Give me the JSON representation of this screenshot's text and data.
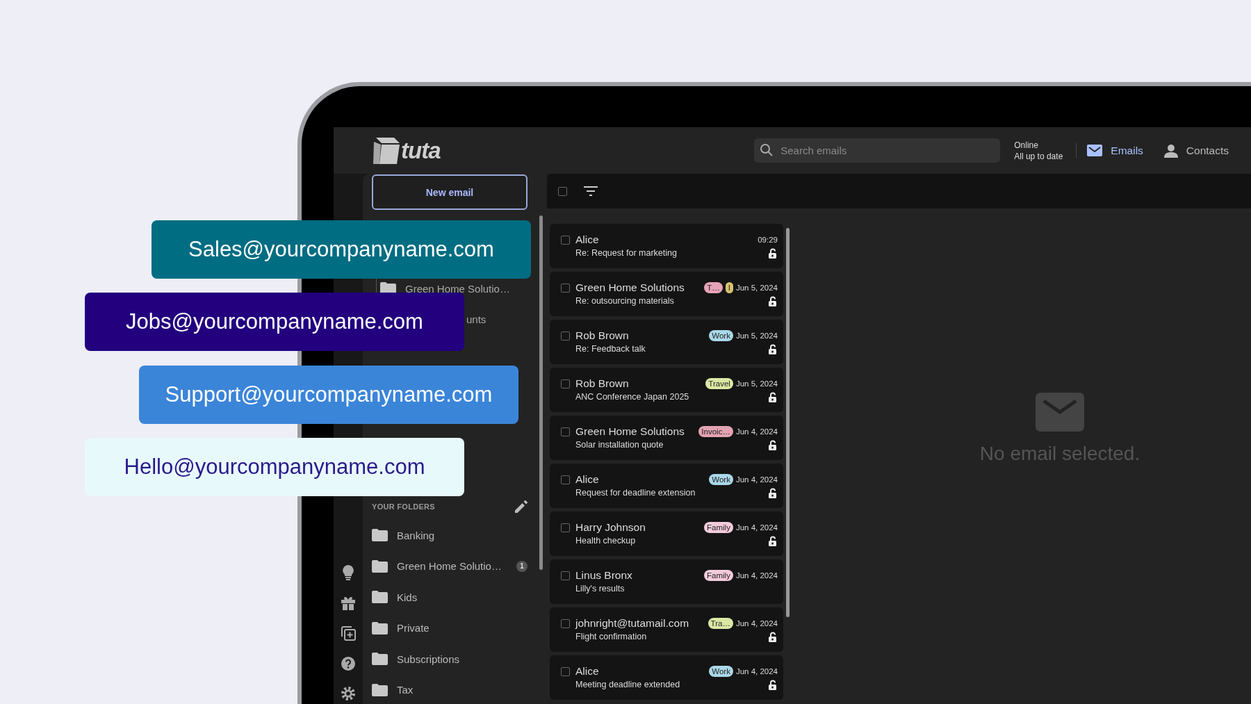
{
  "promo_cards": [
    {
      "address": "Sales@yourcompanyname.com",
      "color": "#006d82"
    },
    {
      "address": "Jobs@yourcompanyname.com",
      "color": "#22007e"
    },
    {
      "address": "Support@yourcompanyname.com",
      "color": "#3b85d9"
    },
    {
      "address": "Hello@yourcompanyname.com",
      "color": "#e8f9fc"
    }
  ],
  "app": {
    "logo_text": "tuta",
    "search": {
      "placeholder": "Search emails"
    },
    "status": {
      "connection": "Online",
      "sync": "All up to date"
    },
    "nav": [
      {
        "label": "Emails",
        "kind": "mail",
        "selected": true
      },
      {
        "label": "Contacts",
        "kind": "contacts",
        "selected": false
      }
    ]
  },
  "sidebar": {
    "new_email_button": "New email",
    "partial_folders": [
      {
        "label": "Green Home Solutio…",
        "kind": "subfolder"
      },
      {
        "label": "unts",
        "kind": "clipped"
      }
    ],
    "your_folders": {
      "heading": "YOUR FOLDERS",
      "items": [
        {
          "label": "Banking"
        },
        {
          "label": "Green Home Solutio…",
          "badge": "1"
        },
        {
          "label": "Kids"
        },
        {
          "label": "Private"
        },
        {
          "label": "Subscriptions"
        },
        {
          "label": "Tax"
        }
      ]
    }
  },
  "toolbar": {
    "select_all_checked": false
  },
  "emails": [
    {
      "sender": "Alice",
      "subject": "Re: Request for marketing",
      "date": "09:29",
      "encrypted": true,
      "checked": false
    },
    {
      "sender": "Green Home Solutions",
      "subject": "Re: outsourcing materials",
      "date": "Jun 5, 2024",
      "tags": [
        {
          "label": "T…",
          "color": "#e8a3b8"
        },
        {
          "label": "I",
          "color": "#d9c170"
        }
      ],
      "encrypted": true,
      "checked": false
    },
    {
      "sender": "Rob Brown",
      "subject": "Re: Feedback talk",
      "date": "Jun 5, 2024",
      "tags": [
        {
          "label": "Work",
          "color": "#a9d8e8"
        }
      ],
      "encrypted": true,
      "checked": false
    },
    {
      "sender": "Rob Brown",
      "subject": "ANC Conference Japan 2025",
      "date": "Jun 5, 2024",
      "tags": [
        {
          "label": "Travel",
          "color": "#dbe8a3"
        }
      ],
      "encrypted": true,
      "checked": false
    },
    {
      "sender": "Green Home Solutions",
      "subject": "Solar installation quote",
      "date": "Jun 4, 2024",
      "tags": [
        {
          "label": "Invoic…",
          "color": "#e3a3b3"
        }
      ],
      "encrypted": true,
      "checked": false
    },
    {
      "sender": "Alice",
      "subject": "Request for deadline extension",
      "date": "Jun 4, 2024",
      "tags": [
        {
          "label": "Work",
          "color": "#a9d8e8"
        }
      ],
      "encrypted": true,
      "checked": false
    },
    {
      "sender": "Harry Johnson",
      "subject": "Health checkup",
      "date": "Jun 4, 2024",
      "tags": [
        {
          "label": "Family",
          "color": "#f2cbdc"
        }
      ],
      "encrypted": true,
      "checked": false
    },
    {
      "sender": "Linus Bronx",
      "subject": "Lilly's results",
      "date": "Jun 4, 2024",
      "tags": [
        {
          "label": "Family",
          "color": "#f2cbdc"
        }
      ],
      "encrypted": false,
      "checked": false
    },
    {
      "sender": "johnright@tutamail.com",
      "subject": "Flight confirmation",
      "date": "Jun 4, 2024",
      "tags": [
        {
          "label": "Tra…",
          "color": "#dbe8a3"
        }
      ],
      "encrypted": true,
      "checked": false
    },
    {
      "sender": "Alice",
      "subject": "Meeting deadline extended",
      "date": "Jun 4, 2024",
      "tags": [
        {
          "label": "Work",
          "color": "#a9d8e8"
        }
      ],
      "encrypted": true,
      "checked": false
    }
  ],
  "detail": {
    "message": "No email selected."
  }
}
